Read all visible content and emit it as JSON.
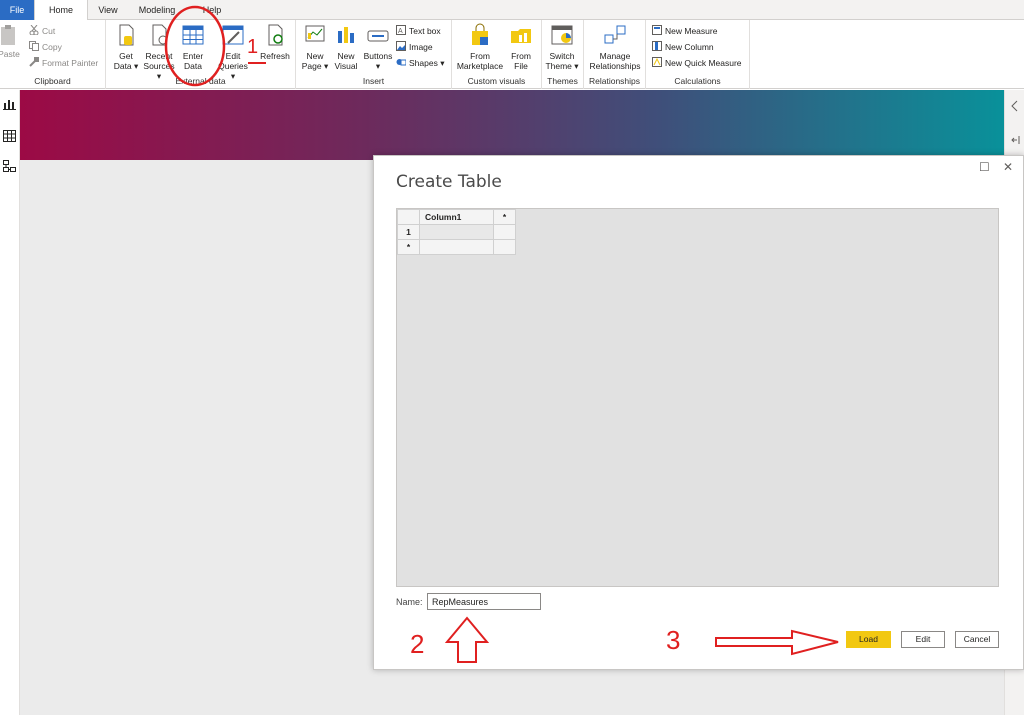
{
  "tabs": [
    {
      "label": "File"
    },
    {
      "label": "Home"
    },
    {
      "label": "View"
    },
    {
      "label": "Modeling"
    },
    {
      "label": "Help"
    }
  ],
  "ribbon": {
    "clipboard": {
      "paste": "Paste",
      "cut": "Cut",
      "copy": "Copy",
      "format_painter": "Format Painter",
      "label": "Clipboard"
    },
    "external_data": {
      "get_data": [
        "Get",
        "Data ▾"
      ],
      "recent_sources": [
        "Recent",
        "Sources ▾"
      ],
      "enter_data": [
        "Enter",
        "Data"
      ],
      "edit_queries": [
        "Edit",
        "Queries ▾"
      ],
      "refresh": "Refresh",
      "label": "External data"
    },
    "insert": {
      "new_page": [
        "New",
        "Page ▾"
      ],
      "new_visual": [
        "New",
        "Visual"
      ],
      "buttons": [
        "Buttons",
        "▾"
      ],
      "text_box": "Text box",
      "image": "Image",
      "shapes": "Shapes ▾",
      "label": "Insert"
    },
    "custom_visuals": {
      "from_marketplace": [
        "From",
        "Marketplace"
      ],
      "from_file": [
        "From",
        "File"
      ],
      "label": "Custom visuals"
    },
    "themes": {
      "switch_theme": [
        "Switch",
        "Theme ▾"
      ],
      "label": "Themes"
    },
    "relationships": {
      "manage_relationships": [
        "Manage",
        "Relationships"
      ],
      "label": "Relationships"
    },
    "calculations": {
      "new_measure": "New Measure",
      "new_column": "New Column",
      "new_quick_measure": "New Quick Measure",
      "label": "Calculations"
    }
  },
  "dialog": {
    "title": "Create Table",
    "maximize_glyph": "☐",
    "close_glyph": "✕",
    "table": {
      "columns": [
        "Column1",
        "*"
      ],
      "rows": [
        {
          "header": "1",
          "cells": [
            "",
            ""
          ]
        },
        {
          "header": "*",
          "cells": [
            "",
            ""
          ]
        }
      ]
    },
    "name_label": "Name:",
    "name_value": "RepMeasures",
    "buttons": {
      "load": "Load",
      "edit": "Edit",
      "cancel": "Cancel"
    }
  },
  "annotations": {
    "step1": "1",
    "step2": "2",
    "step3": "3"
  },
  "colors": {
    "accent": "#2b6cc4",
    "load_button": "#f2c811",
    "annotation": "#e02020"
  }
}
